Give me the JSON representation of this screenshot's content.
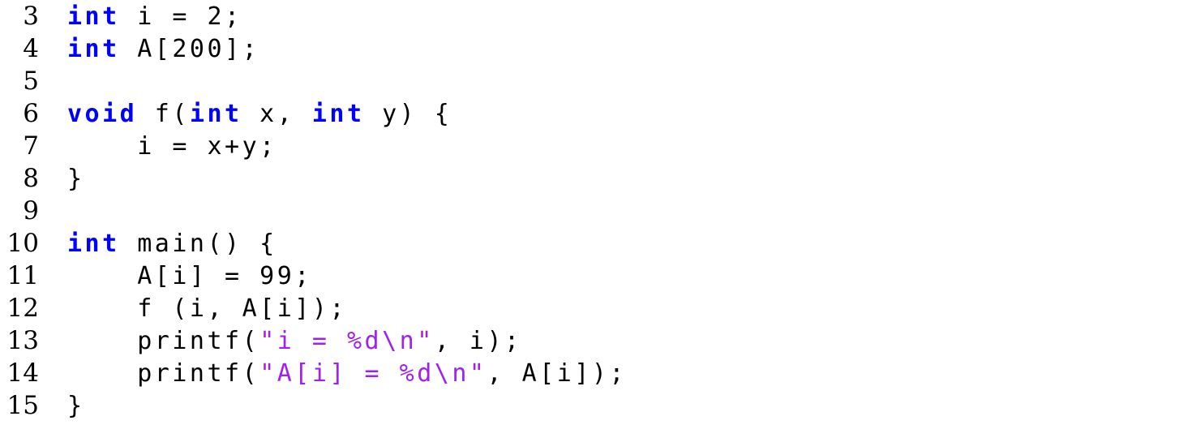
{
  "document": {
    "kind": "source-code-listing",
    "language": "C",
    "background_color": "#ffffff",
    "first_line_number": 3,
    "last_line_number": 15
  },
  "theme": {
    "text_color": "#000000",
    "keyword_color": "#0000ff",
    "string_color": "#a020f0",
    "line_number_color": "#000000",
    "background_color": "#ffffff"
  },
  "lines": [
    {
      "number": "3",
      "text": "int i = 2;",
      "tokens": [
        {
          "kind": "keyword",
          "text": "int"
        },
        {
          "kind": "plain",
          "text": " i = 2;"
        }
      ]
    },
    {
      "number": "4",
      "text": "int A[200];",
      "tokens": [
        {
          "kind": "keyword",
          "text": "int"
        },
        {
          "kind": "plain",
          "text": " A[200];"
        }
      ]
    },
    {
      "number": "5",
      "text": "",
      "tokens": []
    },
    {
      "number": "6",
      "text": "void f(int x, int y) {",
      "tokens": [
        {
          "kind": "keyword",
          "text": "void"
        },
        {
          "kind": "plain",
          "text": " f("
        },
        {
          "kind": "keyword",
          "text": "int"
        },
        {
          "kind": "plain",
          "text": " x, "
        },
        {
          "kind": "keyword",
          "text": "int"
        },
        {
          "kind": "plain",
          "text": " y) {"
        }
      ]
    },
    {
      "number": "7",
      "text": "    i = x+y;",
      "tokens": [
        {
          "kind": "plain",
          "text": "    i = x+y;"
        }
      ]
    },
    {
      "number": "8",
      "text": "}",
      "tokens": [
        {
          "kind": "plain",
          "text": "}"
        }
      ]
    },
    {
      "number": "9",
      "text": "",
      "tokens": []
    },
    {
      "number": "10",
      "text": "int main() {",
      "tokens": [
        {
          "kind": "keyword",
          "text": "int"
        },
        {
          "kind": "plain",
          "text": " main() {"
        }
      ]
    },
    {
      "number": "11",
      "text": "    A[i] = 99;",
      "tokens": [
        {
          "kind": "plain",
          "text": "    A[i] = 99;"
        }
      ]
    },
    {
      "number": "12",
      "text": "    f (i, A[i]);",
      "tokens": [
        {
          "kind": "plain",
          "text": "    f (i, A[i]);"
        }
      ]
    },
    {
      "number": "13",
      "text": "    printf(\"i = %d\\n\", i);",
      "tokens": [
        {
          "kind": "plain",
          "text": "    printf("
        },
        {
          "kind": "string",
          "text": "\"i = %d\\n\""
        },
        {
          "kind": "plain",
          "text": ", i);"
        }
      ]
    },
    {
      "number": "14",
      "text": "    printf(\"A[i] = %d\\n\", A[i]);",
      "tokens": [
        {
          "kind": "plain",
          "text": "    printf("
        },
        {
          "kind": "string",
          "text": "\"A[i] = %d\\n\""
        },
        {
          "kind": "plain",
          "text": ", A[i]);"
        }
      ]
    },
    {
      "number": "15",
      "text": "}",
      "tokens": [
        {
          "kind": "plain",
          "text": "}"
        }
      ]
    }
  ]
}
